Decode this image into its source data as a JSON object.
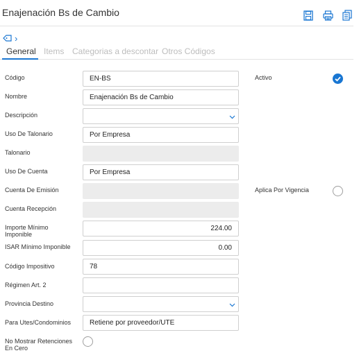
{
  "header": {
    "title": "Enajenación Bs de Cambio",
    "toolbar": [
      {
        "icon": "save-icon"
      },
      {
        "icon": "print-icon"
      },
      {
        "icon": "copy-icon"
      }
    ]
  },
  "breadcrumb": {
    "icon": "tag-icon",
    "separator": "›"
  },
  "tabs": [
    "General",
    "Items",
    "Categorias a descontar",
    "Otros Códigos"
  ],
  "form": {
    "codigo": {
      "label": "Código",
      "value": "EN-BS"
    },
    "nombre": {
      "label": "Nombre",
      "value": "Enajenación Bs de Cambio"
    },
    "descripcion": {
      "label": "Descripción",
      "value": ""
    },
    "uso_talonario": {
      "label": "Uso De Talonario",
      "value": "Por Empresa"
    },
    "talonario": {
      "label": "Talonario",
      "value": ""
    },
    "uso_cuenta": {
      "label": "Uso De Cuenta",
      "value": "Por Empresa"
    },
    "cuenta_emision": {
      "label": "Cuenta De Emisión",
      "value": ""
    },
    "cuenta_recepcion": {
      "label": "Cuenta Recepción",
      "value": ""
    },
    "importe_minimo": {
      "label_line1": "Importe Mínimo",
      "label_line2": "Imponible",
      "value": "224.00"
    },
    "isar_minimo": {
      "label": "ISAR Mínimo Imponible",
      "value": "0.00"
    },
    "codigo_impositivo": {
      "label": "Código Impositivo",
      "value": "78"
    },
    "regimen": {
      "label": "Régimen Art. 2",
      "value": ""
    },
    "provincia_destino": {
      "label": "Provincia Destino",
      "value": ""
    },
    "utes": {
      "label": "Para Utes/Condominios",
      "value": "Retiene por proveedor/UTE"
    },
    "no_mostrar": {
      "label_line1": "No Mostrar Retenciones",
      "label_line2": "En Cero",
      "checked": false
    }
  },
  "right": {
    "activo": {
      "label": "Activo",
      "checked": true
    },
    "aplica_vigencia": {
      "label": "Aplica Por Vigencia",
      "checked": false
    }
  },
  "colors": {
    "accent": "#1976d2",
    "muted_tab": "#bdbdbd",
    "disabled_field": "#ececec"
  }
}
